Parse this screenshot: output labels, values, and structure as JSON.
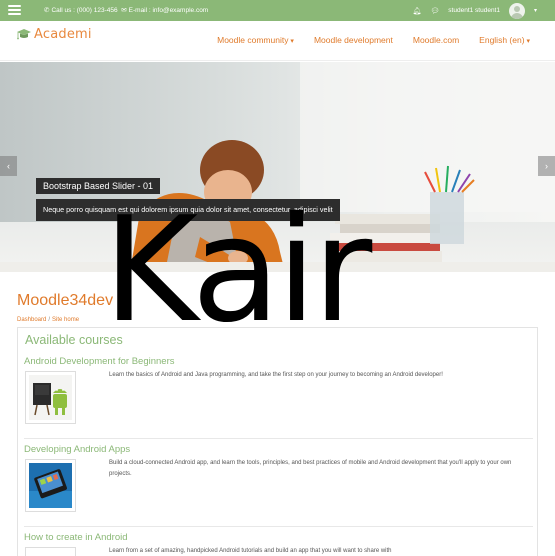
{
  "topbar": {
    "phone": "Call us : (000) 123-456",
    "email": "E-mail : info@example.com",
    "username": "student1 student1"
  },
  "header": {
    "logo_text": "Academi",
    "nav": [
      {
        "label": "Moodle community"
      },
      {
        "label": "Moodle development"
      },
      {
        "label": "Moodle.com"
      },
      {
        "label": "English (en)"
      }
    ]
  },
  "slider": {
    "title": "Bootstrap Based Slider - 01",
    "text": "Neque porro quisquam est qui dolorem ipsum quia dolor sit amet, consectetur, adipisci velit",
    "prev_glyph": "‹",
    "next_glyph": "›"
  },
  "watermark": "Kair",
  "page": {
    "title": "Moodle34dev",
    "breadcrumb": [
      "Dashboard",
      "Site home"
    ]
  },
  "courses": {
    "heading": "Available courses",
    "items": [
      {
        "name": "Android Development for Beginners",
        "summary": "Learn the basics of Android and Java programming, and take the first step on your journey to becoming an Android developer!"
      },
      {
        "name": "Developing Android Apps",
        "summary": "Build a cloud-connected Android app, and learn the tools, principles, and best practices of mobile and Android development that you'll apply to your own projects."
      },
      {
        "name": "How to create in Android",
        "summary": "Learn from a set of amazing, handpicked Android tutorials and build an app that you will want to share with"
      }
    ]
  },
  "colors": {
    "topbar": "#8bb877",
    "accent_orange": "#e07b2c",
    "accent_green": "#8bb877"
  },
  "icons": [
    "menu-icon",
    "phone-icon",
    "mail-icon",
    "bell-icon",
    "chat-icon",
    "user-avatar",
    "graduation-cap-icon"
  ]
}
